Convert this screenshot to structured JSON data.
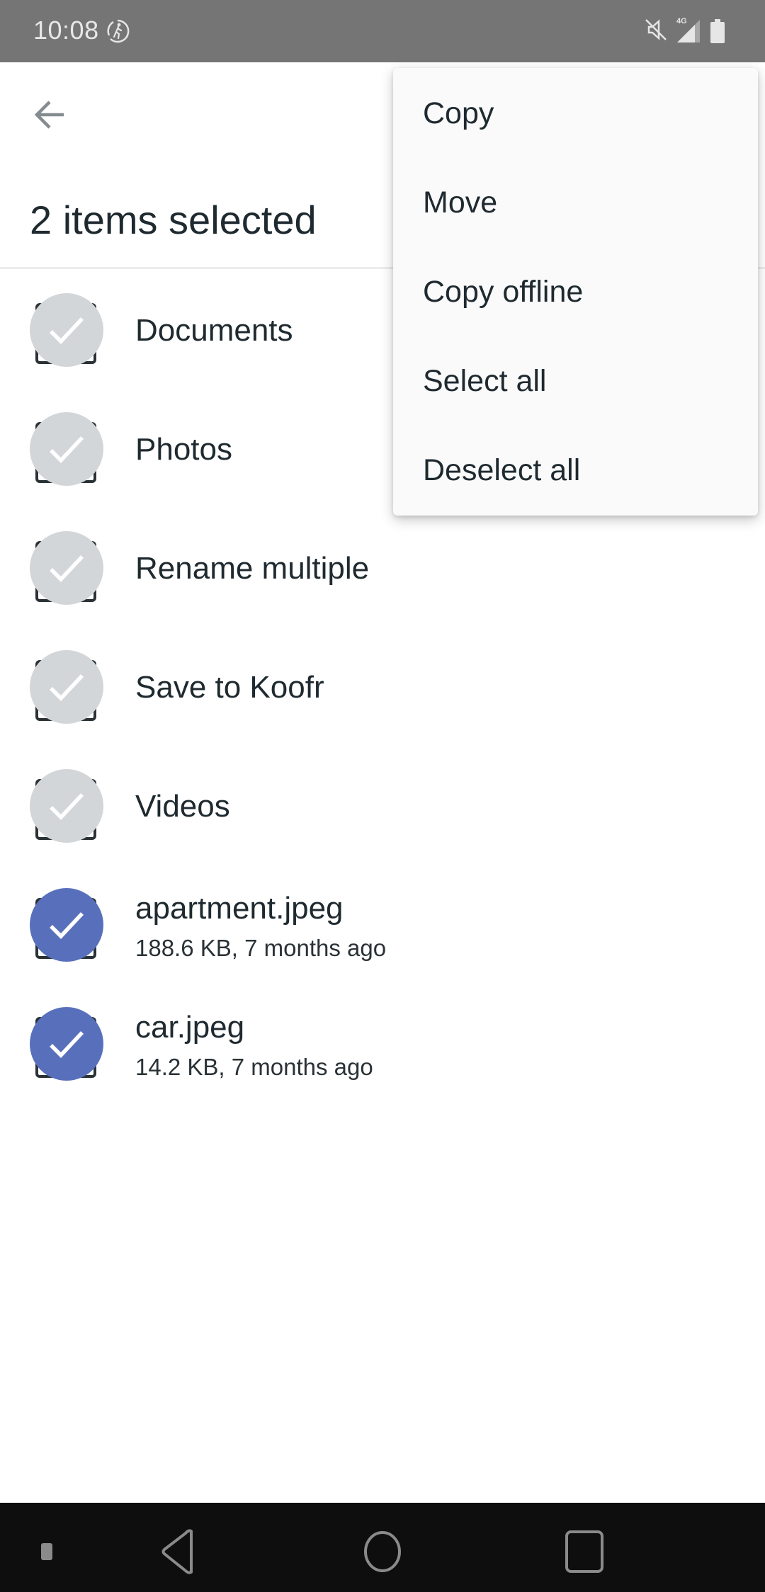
{
  "status_bar": {
    "time": "10:08",
    "icons": [
      "running-activity-icon",
      "mute-icon",
      "signal-4g-icon",
      "battery-icon"
    ],
    "network_label": "4G"
  },
  "app_bar": {
    "back_icon": "arrow-back-icon",
    "title": "2 items selected"
  },
  "colors": {
    "accent": "#5870bb",
    "unselected_check": "#d3d6d9",
    "text": "#1f2a30",
    "status_bar": "#757575",
    "nav_bar": "#0e0e0e",
    "menu_bg": "#fafafa"
  },
  "list": {
    "items": [
      {
        "name": "Documents",
        "meta": "",
        "selected": false
      },
      {
        "name": "Photos",
        "meta": "",
        "selected": false
      },
      {
        "name": "Rename multiple",
        "meta": "",
        "selected": false
      },
      {
        "name": "Save to Koofr",
        "meta": "",
        "selected": false
      },
      {
        "name": "Videos",
        "meta": "",
        "selected": false
      },
      {
        "name": "apartment.jpeg",
        "meta": "188.6 KB, 7 months ago",
        "selected": true
      },
      {
        "name": "car.jpeg",
        "meta": "14.2 KB, 7 months ago",
        "selected": true
      }
    ]
  },
  "menu": {
    "items": [
      {
        "label": "Copy"
      },
      {
        "label": "Move"
      },
      {
        "label": "Copy offline"
      },
      {
        "label": "Select all"
      },
      {
        "label": "Deselect all"
      }
    ]
  },
  "nav_bar": {
    "buttons": [
      "back-icon",
      "home-icon",
      "recents-icon"
    ]
  }
}
